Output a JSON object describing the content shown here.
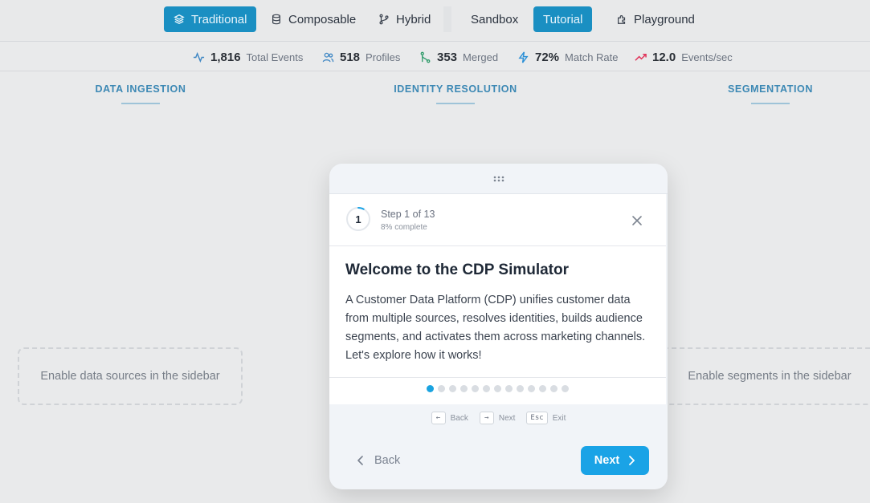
{
  "nav": {
    "architecture": [
      {
        "label": "Traditional",
        "icon": "layers-icon",
        "active": true
      },
      {
        "label": "Composable",
        "icon": "database-icon",
        "active": false
      },
      {
        "label": "Hybrid",
        "icon": "git-branch-icon",
        "active": false
      }
    ],
    "modes": [
      {
        "label": "Sandbox",
        "active": false
      },
      {
        "label": "Tutorial",
        "active": true
      },
      {
        "label": "Playground",
        "icon": "puzzle-icon",
        "active": false
      }
    ]
  },
  "stats": [
    {
      "value": "1,816",
      "label": "Total Events",
      "icon": "activity-icon",
      "color": "#3f87c4"
    },
    {
      "value": "518",
      "label": "Profiles",
      "icon": "users-icon",
      "color": "#3f87c4"
    },
    {
      "value": "353",
      "label": "Merged",
      "icon": "merge-icon",
      "color": "#2f9a6a"
    },
    {
      "value": "72%",
      "label": "Match Rate",
      "icon": "zap-icon",
      "color": "#2a8fd6"
    },
    {
      "value": "12.0",
      "label": "Events/sec",
      "icon": "trending-up-icon",
      "color": "#e0345a"
    }
  ],
  "columns": [
    {
      "heading": "DATA INGESTION",
      "empty": "Enable data sources in the sidebar"
    },
    {
      "heading": "IDENTITY RESOLUTION"
    },
    {
      "heading": "SEGMENTATION",
      "empty": "Enable segments in the sidebar"
    }
  ],
  "tutorial": {
    "step_number": "1",
    "step_label": "Step 1 of 13",
    "progress_label": "8% complete",
    "progress": 0.08,
    "total_steps": 13,
    "current_step": 1,
    "title": "Welcome to the CDP Simulator",
    "body": "A Customer Data Platform (CDP) unifies customer data from multiple sources, resolves identities, builds audience segments, and activates them across marketing channels. Let's explore how it works!",
    "hints": [
      {
        "key": "←",
        "label": "Back"
      },
      {
        "key": "→",
        "label": "Next"
      },
      {
        "key": "Esc",
        "label": "Exit"
      }
    ],
    "back_label": "Back",
    "next_label": "Next",
    "accent": "#1aa3e6"
  }
}
